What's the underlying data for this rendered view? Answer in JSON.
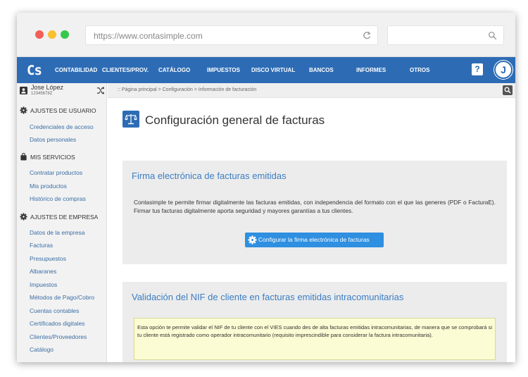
{
  "browser": {
    "url": "https://www.contasimple.com"
  },
  "navbar": {
    "logo": "Cs",
    "items": [
      "CONTABILIDAD",
      "CLIENTES/PROV.",
      "CATÁLOGO",
      "IMPUESTOS",
      "DISCO VIRTUAL",
      "BANCOS",
      "INFORMES",
      "OTROS"
    ],
    "help": "?",
    "avatar_initial": "J",
    "brand_color": "#2d6cb5"
  },
  "sidebar": {
    "user_name": "Jose López",
    "user_id": "12345678Z",
    "sections": [
      {
        "title": "AJUSTES DE USUARIO",
        "icon": "gear-icon",
        "links": [
          "Credenciales de acceso",
          "Datos personales"
        ]
      },
      {
        "title": "MIS SERVICIOS",
        "icon": "bag-icon",
        "links": [
          "Contratar productos",
          "Mis productos",
          "Histórico de compras"
        ]
      },
      {
        "title": "AJUSTES DE EMPRESA",
        "icon": "gear-icon",
        "links": [
          "Datos de la empresa",
          "Facturas",
          "Presupuestos",
          "Albaranes",
          "Impuestos",
          "Métodos de Pago/Cobro",
          "Cuentas contables",
          "Certificados digitales",
          "Clientes/Proveedores",
          "Catálogo"
        ]
      }
    ]
  },
  "breadcrumb": ":: Página principal > Configuración > Información de facturación",
  "page_title": "Configuración general de facturas",
  "panel1": {
    "title": "Firma electrónica de facturas emitidas",
    "text": "Contasimple te permite firmar digitalmente las facturas emitidas, con independencia del formato con el que las generes (PDF o FacturaE). Firmar tus facturas digitalmente aporta seguridad y mayores garantías a tus clientes.",
    "button": "Configurar la firma electrónica de facturas"
  },
  "panel2": {
    "title": "Validación del NIF de cliente en facturas emitidas intracomunitarias",
    "note": "Esta opción te permite validar el NIF de tu cliente con el VIES cuando des de alta facturas emitidas intracomunitarias, de manera que se comprobará si tu cliente está registrado como operador intracomunitario (requisito imprescindible para considerar la factura intracomunitaria)."
  }
}
